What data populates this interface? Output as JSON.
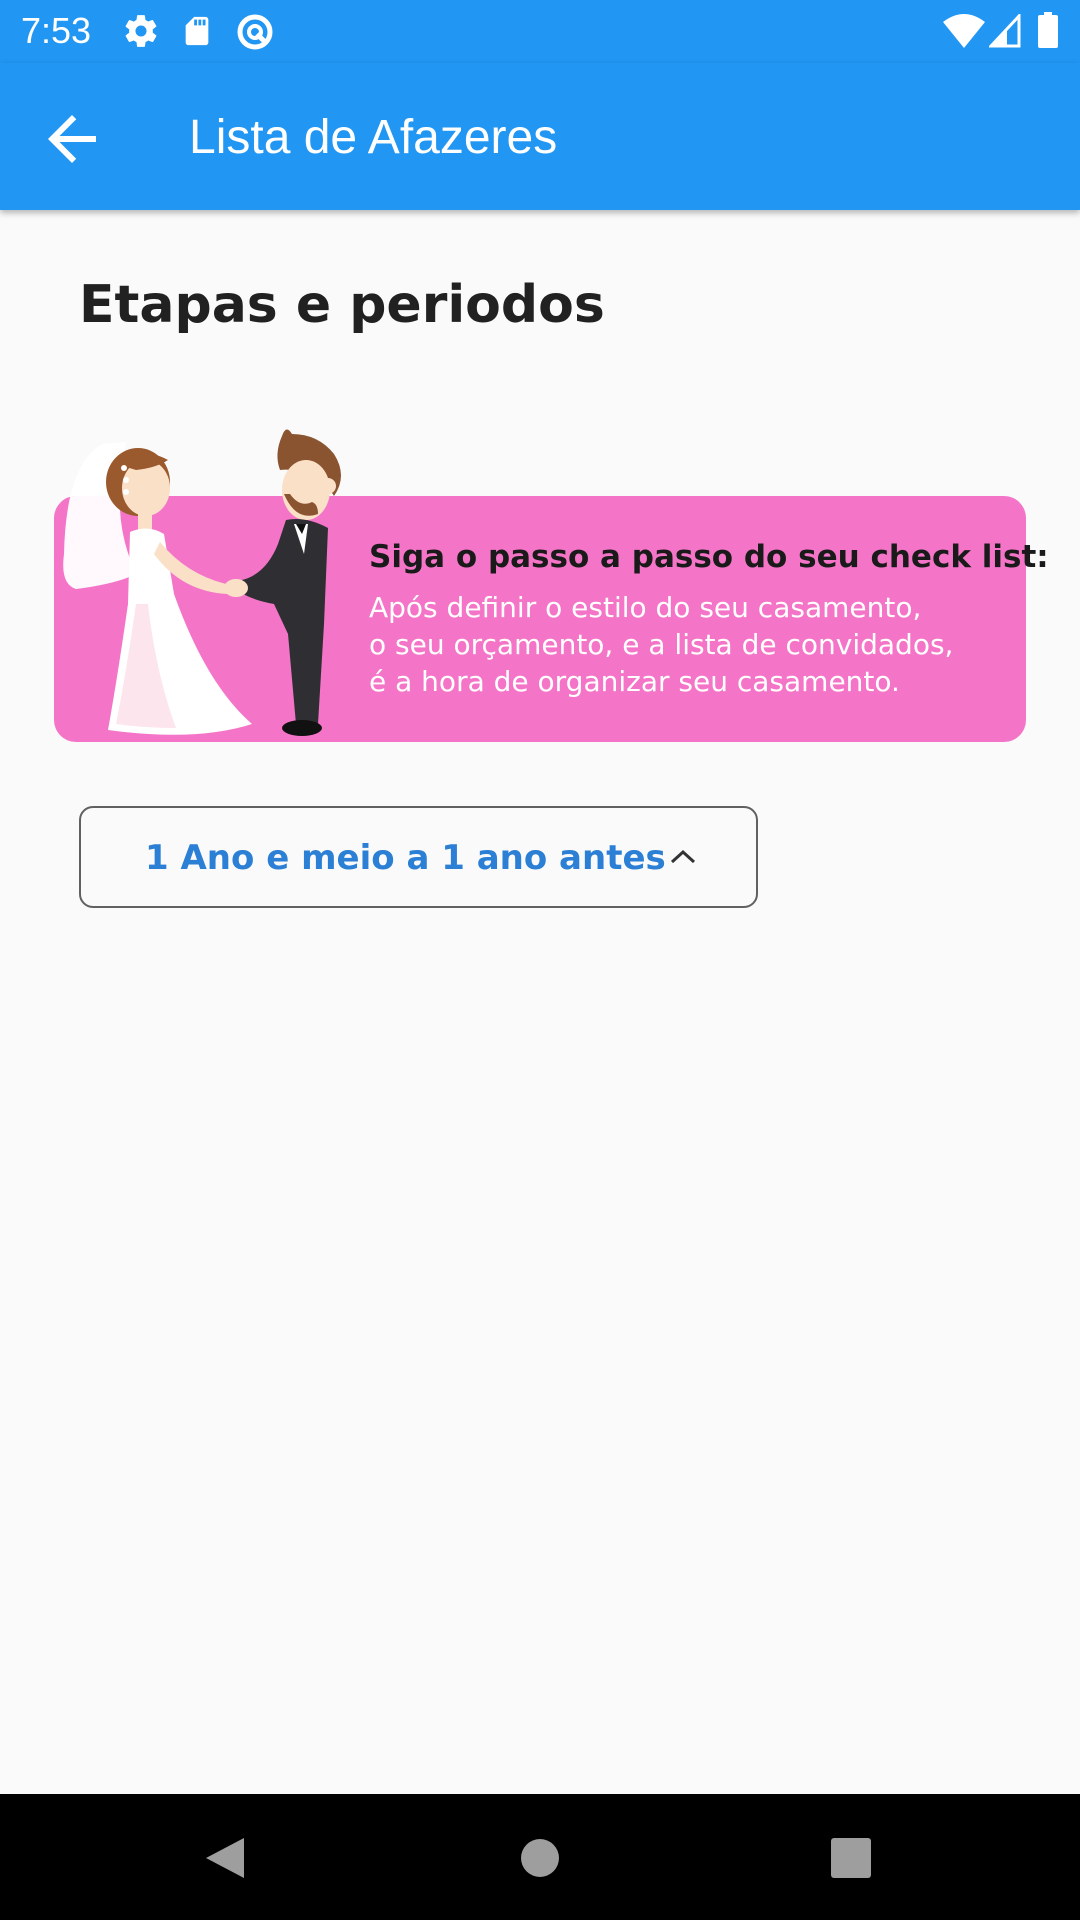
{
  "status_bar": {
    "time": "7:53",
    "left_icons": [
      "settings-icon",
      "sd-card-icon",
      "circle-at-icon"
    ],
    "right_icons": [
      "wifi-icon",
      "signal-icon",
      "battery-icon"
    ]
  },
  "app_bar": {
    "back_icon": "arrow-back-icon",
    "title": "Lista de Afazeres",
    "color": "#2196f3"
  },
  "page": {
    "heading": "Etapas e periodos"
  },
  "banner": {
    "title": "Siga o passo a passo do seu check list:",
    "lines": [
      "Após definir o estilo do seu casamento,",
      "o seu orçamento, e a lista de convidados,",
      "é a hora de organizar seu casamento."
    ],
    "illustration": "bride-and-groom-illustration",
    "color": "#f475c8"
  },
  "period_select": {
    "label": "1 Ano e meio a 1 ano antes",
    "icon": "chevron-up-icon",
    "label_color": "#2b7fd4"
  },
  "nav_bar": {
    "buttons": [
      "back-triangle-icon",
      "home-circle-icon",
      "recents-square-icon"
    ]
  }
}
